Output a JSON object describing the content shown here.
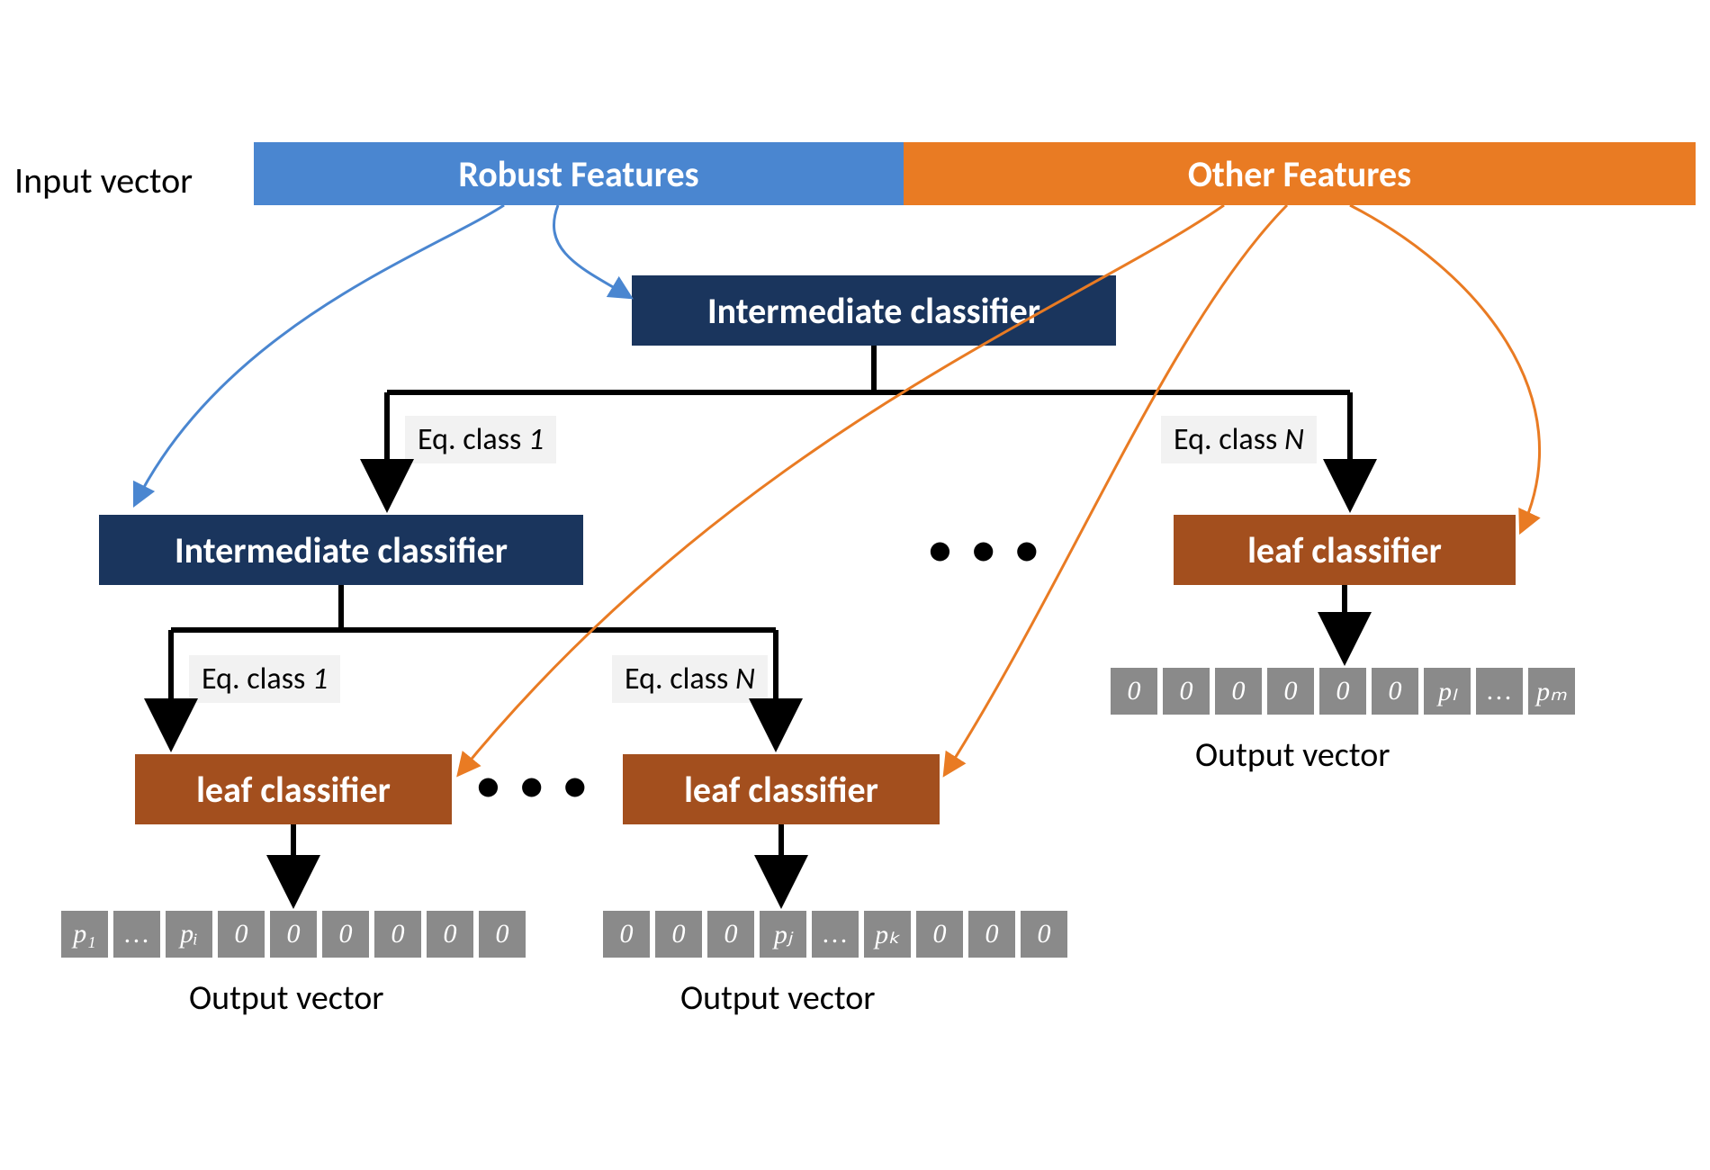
{
  "labels": {
    "input_vector": "Input vector",
    "robust_features": "Robust Features",
    "other_features": "Other Features",
    "intermediate_classifier": "Intermediate classifier",
    "leaf_classifier": "leaf classifier",
    "eq_class_1_prefix": "Eq. class ",
    "eq_class_1_num": "1",
    "eq_class_N_prefix": "Eq. class ",
    "eq_class_N_num": "N",
    "ellipsis": "• • •",
    "output_vector": "Output vector"
  },
  "vectors": {
    "left": [
      "p₁",
      "…",
      "pᵢ",
      "0",
      "0",
      "0",
      "0",
      "0",
      "0"
    ],
    "mid": [
      "0",
      "0",
      "0",
      "pⱼ",
      "…",
      "pₖ",
      "0",
      "0",
      "0"
    ],
    "right": [
      "0",
      "0",
      "0",
      "0",
      "0",
      "0",
      "pₗ",
      "…",
      "pₘ"
    ]
  },
  "colors": {
    "robust": "#4a86d0",
    "other": "#e97b23",
    "intermediate": "#1a355d",
    "leaf": "#a34f1e",
    "cell": "#8a8a8a",
    "black": "#000000"
  }
}
